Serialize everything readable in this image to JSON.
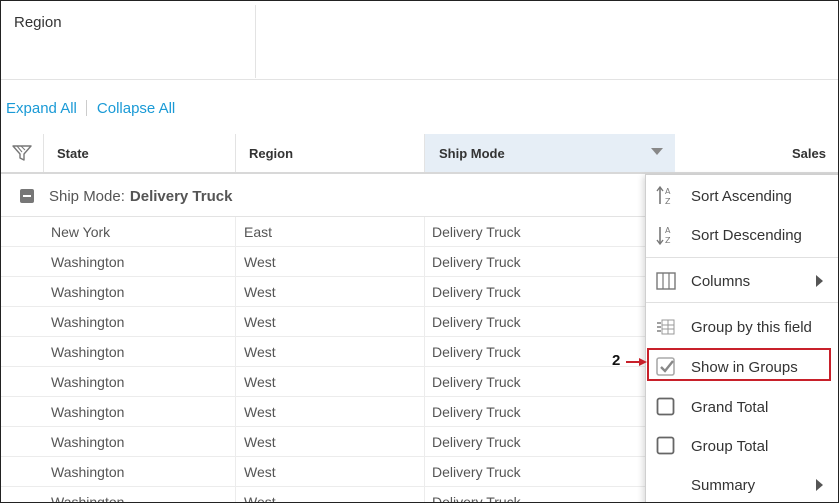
{
  "region_panel": {
    "label": "Region"
  },
  "toolbar": {
    "expand_all": "Expand All",
    "collapse_all": "Collapse All"
  },
  "grid": {
    "columns": [
      {
        "key": "state",
        "label": "State"
      },
      {
        "key": "region",
        "label": "Region"
      },
      {
        "key": "ship_mode",
        "label": "Ship Mode"
      },
      {
        "key": "sales",
        "label": "Sales"
      }
    ],
    "group": {
      "prefix": "Ship Mode:",
      "value": "Delivery Truck"
    },
    "rows": [
      {
        "state": "New York",
        "region": "East",
        "ship_mode": "Delivery Truck"
      },
      {
        "state": "Washington",
        "region": "West",
        "ship_mode": "Delivery Truck"
      },
      {
        "state": "Washington",
        "region": "West",
        "ship_mode": "Delivery Truck"
      },
      {
        "state": "Washington",
        "region": "West",
        "ship_mode": "Delivery Truck"
      },
      {
        "state": "Washington",
        "region": "West",
        "ship_mode": "Delivery Truck"
      },
      {
        "state": "Washington",
        "region": "West",
        "ship_mode": "Delivery Truck"
      },
      {
        "state": "Washington",
        "region": "West",
        "ship_mode": "Delivery Truck"
      },
      {
        "state": "Washington",
        "region": "West",
        "ship_mode": "Delivery Truck"
      },
      {
        "state": "Washington",
        "region": "West",
        "ship_mode": "Delivery Truck"
      },
      {
        "state": "Washington",
        "region": "West",
        "ship_mode": "Delivery Truck"
      }
    ]
  },
  "context_menu": {
    "items": [
      {
        "label": "Sort Ascending",
        "icon": "sort-ascending-icon"
      },
      {
        "label": "Sort Descending",
        "icon": "sort-descending-icon"
      },
      {
        "label": "Columns",
        "icon": "columns-icon",
        "submenu": true
      },
      {
        "label": "Group by this field",
        "icon": "group-by-icon"
      },
      {
        "label": "Show in Groups",
        "icon": "checkbox-checked-icon",
        "checked": true
      },
      {
        "label": "Grand Total",
        "icon": "checkbox-icon",
        "checked": false
      },
      {
        "label": "Group Total",
        "icon": "checkbox-icon",
        "checked": false
      },
      {
        "label": "Summary",
        "icon": "",
        "submenu": true
      }
    ]
  },
  "callout": {
    "number": "2"
  },
  "colors": {
    "link": "#1a9ad6",
    "highlight": "#c8202a",
    "header_selected": "#e6eef6"
  }
}
